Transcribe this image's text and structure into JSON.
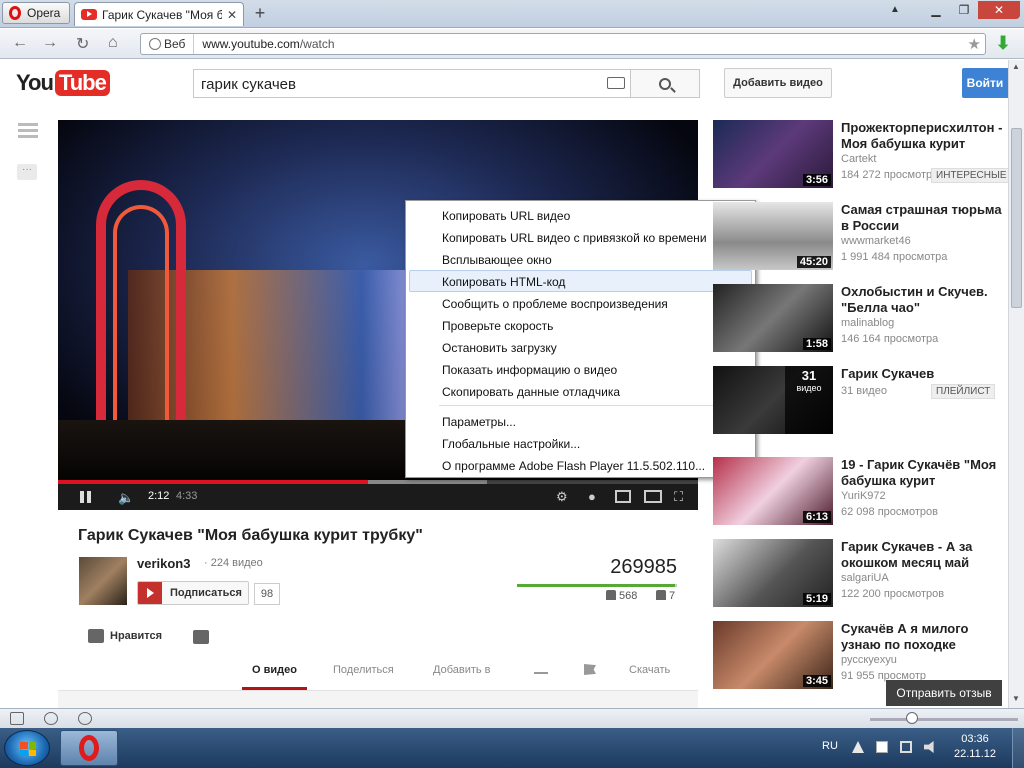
{
  "browser": {
    "menu_label": "Opera",
    "tab_title": "Гарик Сукачев \"Моя б...",
    "address_badge": "Веб",
    "url_host": "www.youtube.com",
    "url_path": "/watch"
  },
  "header": {
    "logo_you": "You",
    "logo_tube": "Tube",
    "search_value": "гарик сукачев",
    "upload_label": "Добавить видео",
    "signin_label": "Войти"
  },
  "player": {
    "time_current": "2:12",
    "time_total": "4:33",
    "progress": 0.484,
    "buffered": 0.67
  },
  "context_menu": {
    "items": [
      "Копировать URL видео",
      "Копировать URL видео с привязкой ко времени",
      "Всплывающее окно",
      "Копировать HTML-код",
      "Сообщить о проблеме воспроизведения",
      "Проверьте скорость",
      "Остановить загрузку",
      "Показать информацию о видео",
      "Скопировать данные отладчика"
    ],
    "items2": [
      "Параметры...",
      "Глобальные настройки...",
      "О программе Adobe Flash Player 11.5.502.110..."
    ]
  },
  "video": {
    "title": "Гарик Сукачев \"Моя бабушка курит трубку\"",
    "channel": "verikon3",
    "video_count": "· 224 видео",
    "subscribe_label": "Подписаться",
    "subscriber_count": "98",
    "views": "269985",
    "likes": "568",
    "dislikes": "7",
    "like_ratio": 0.988,
    "like_label": "Нравится"
  },
  "tabs": [
    "О видео",
    "Поделиться",
    "Добавить в",
    "Скачать"
  ],
  "sidebar": [
    {
      "title": "Прожекторперисхилтон - Моя бабушка курит",
      "author": "Cartekt",
      "views": "184 272 просмотра",
      "duration": "3:56",
      "badge": "ИНТЕРЕСНЫЕ"
    },
    {
      "title": "Самая страшная тюрьма в России",
      "author": "wwwmarket46",
      "views": "1 991 484 просмотра",
      "duration": "45:20",
      "badge": ""
    },
    {
      "title": "Охлобыстин и Скучев. \"Белла чао\"",
      "author": "malinablog",
      "views": "146 164 просмотра",
      "duration": "1:58",
      "badge": ""
    },
    {
      "title": "Гарик Сукачев",
      "author": "",
      "views": "31 видео",
      "duration": "",
      "badge": "ПЛЕЙЛИСТ",
      "playlist_count": "31",
      "playlist_label": "видео"
    },
    {
      "title": "19 - Гарик Сукачёв \"Моя бабушка курит",
      "author": "YuriK972",
      "views": "62 098 просмотров",
      "duration": "6:13",
      "badge": ""
    },
    {
      "title": "Гарик Сукачев - А за окошком месяц май",
      "author": "salgariUA",
      "views": "122 200 просмотров",
      "duration": "5:19",
      "badge": ""
    },
    {
      "title": "Сукачёв А я милого узнаю по походке",
      "author": "русскуеxyu",
      "views": "91 955 просмотр",
      "duration": "3:45",
      "badge": ""
    }
  ],
  "feedback_label": "Отправить отзыв",
  "taskbar": {
    "lang": "RU",
    "time": "03:36",
    "date": "22.11.12"
  }
}
